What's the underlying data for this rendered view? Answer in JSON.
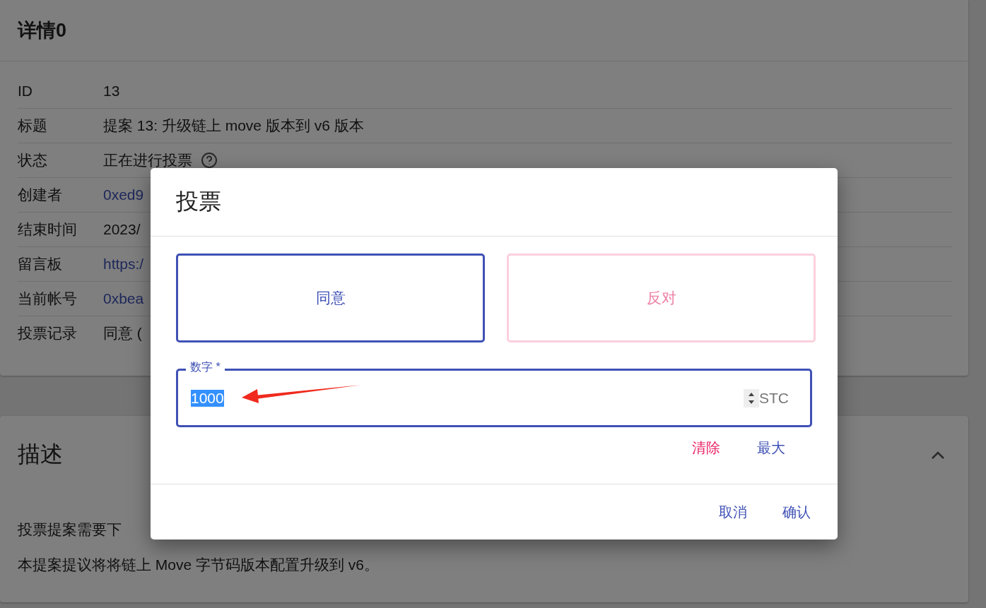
{
  "details": {
    "title": "详情0",
    "rows": [
      {
        "label": "ID",
        "value": "13",
        "kind": "text"
      },
      {
        "label": "标题",
        "value": "提案 13: 升级链上 move 版本到 v6 版本",
        "kind": "text"
      },
      {
        "label": "状态",
        "value": "正在进行投票",
        "kind": "status"
      },
      {
        "label": "创建者",
        "value": "0xed9",
        "kind": "link"
      },
      {
        "label": "结束时间",
        "value": "2023/",
        "kind": "text"
      },
      {
        "label": "留言板",
        "value": "https:/",
        "kind": "link"
      },
      {
        "label": "当前帐号",
        "value": "0xbea",
        "kind": "link"
      },
      {
        "label": "投票记录",
        "value": "同意 (",
        "kind": "text"
      }
    ]
  },
  "description": {
    "title": "描述",
    "expanded": true,
    "paragraphs": [
      "投票提案需要下",
      "本提案提议将将链上 Move 字节码版本配置升级到 v6。"
    ]
  },
  "dialog": {
    "title": "投票",
    "choices": [
      {
        "label": "同意",
        "selected": true
      },
      {
        "label": "反对",
        "selected": false
      }
    ],
    "amount": {
      "label": "数字 *",
      "value": "1000",
      "unit": "STC"
    },
    "actions": [
      {
        "label": "清除",
        "kind": "clear"
      },
      {
        "label": "最大",
        "kind": "max"
      }
    ],
    "buttons": [
      "取消",
      "确认"
    ]
  }
}
